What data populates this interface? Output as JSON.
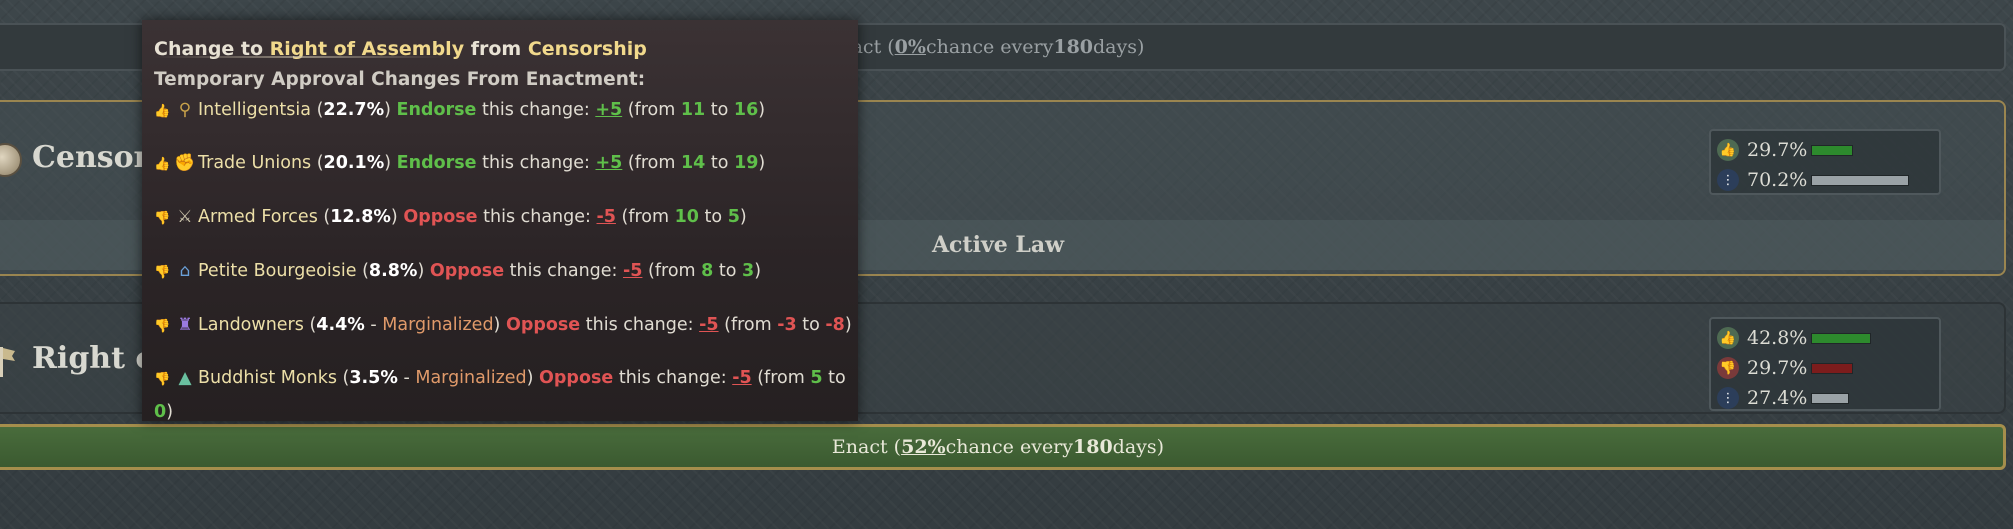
{
  "enact_top": {
    "prefix": "act (",
    "percent": "0%",
    "middle": " chance every ",
    "days": "180",
    "suffix": " days)"
  },
  "censorship_law": {
    "title": "Censors",
    "active_label": "Active Law",
    "stats": [
      {
        "icon": "thumbs-up-icon",
        "value": "29.7%",
        "bar_level": 0.297,
        "color": "#2d8a2d"
      },
      {
        "icon": "neutral-icon",
        "value": "70.2%",
        "bar_level": 0.702,
        "color": "#9aa2a6"
      }
    ]
  },
  "assembly_law": {
    "title": "Right of",
    "stats": [
      {
        "icon": "thumbs-up-icon",
        "value": "42.8%",
        "bar_level": 0.428,
        "color": "#2d8a2d"
      },
      {
        "icon": "thumbs-down-icon",
        "value": "29.7%",
        "bar_level": 0.297,
        "color": "#7c1c1c"
      },
      {
        "icon": "neutral-icon",
        "value": "27.4%",
        "bar_level": 0.274,
        "color": "#9aa2a6"
      }
    ]
  },
  "enact_bottom": {
    "prefix": "Enact (",
    "percent": "52%",
    "middle": " chance every ",
    "days": "180",
    "suffix": " days)"
  },
  "tooltip": {
    "header_pre": "Change to ",
    "to_law": "Right of Assembly",
    "header_mid": " from ",
    "from_law": "Censorship",
    "subheader": "Temporary Approval Changes From Enactment:",
    "groups": [
      {
        "name": "Intelligentsia",
        "pct": "22.7%",
        "marg": "",
        "stance": "Endorse",
        "delta": "+5",
        "from": "11",
        "to": "16",
        "icon": "intelligentsia-icon"
      },
      {
        "name": "Trade Unions",
        "pct": "20.1%",
        "marg": "",
        "stance": "Endorse",
        "delta": "+5",
        "from": "14",
        "to": "19",
        "icon": "trade-unions-icon"
      },
      {
        "name": "Armed Forces",
        "pct": "12.8%",
        "marg": "",
        "stance": "Oppose",
        "delta": "-5",
        "from": "10",
        "to": "5",
        "icon": "armed-forces-icon"
      },
      {
        "name": "Petite Bourgeoisie",
        "pct": "8.8%",
        "marg": "",
        "stance": "Oppose",
        "delta": "-5",
        "from": "8",
        "to": "3",
        "icon": "petite-bourgeoisie-icon"
      },
      {
        "name": "Landowners",
        "pct": "4.4%",
        "marg": "Marginalized",
        "stance": "Oppose",
        "delta": "-5",
        "from": "-3",
        "to": "-8",
        "icon": "landowners-icon"
      },
      {
        "name": "Buddhist Monks",
        "pct": "3.5%",
        "marg": "Marginalized",
        "stance": "Oppose",
        "delta": "-5",
        "from": "5",
        "to": "0",
        "icon": "buddhist-monks-icon"
      }
    ],
    "change_text": " this change: ",
    "from_word": "(from ",
    "to_word": " to ",
    "close": ")"
  }
}
